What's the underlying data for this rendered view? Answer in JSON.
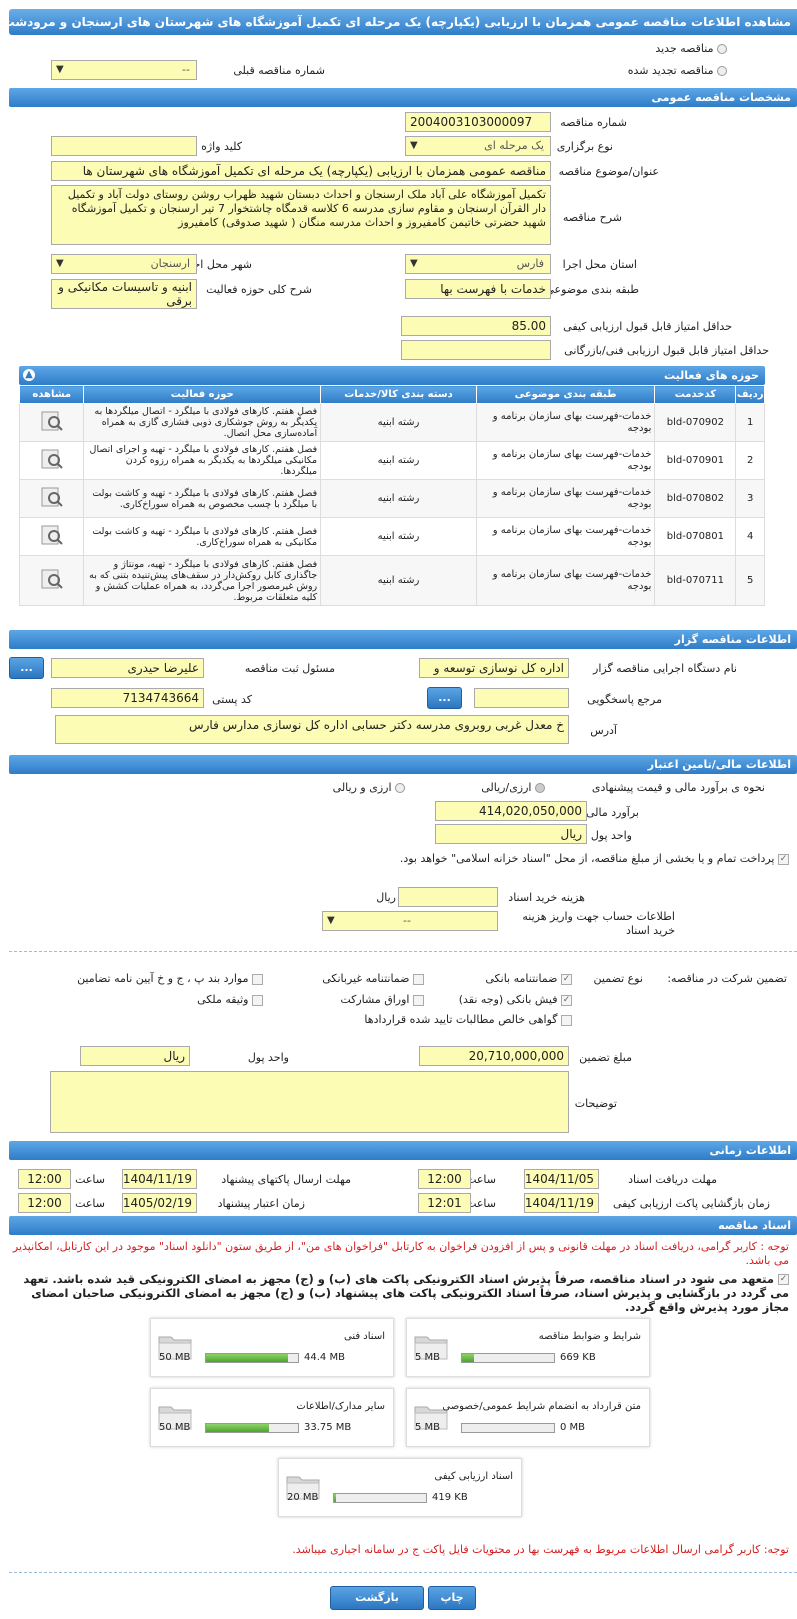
{
  "header": {
    "title": "مشاهده اطلاعات مناقصه عمومی همزمان با ارزیابی (یکپارچه) یک مرحله ای تکمیل آموزشگاه های شهرستان های ارسنجان و مرودشت"
  },
  "top": {
    "new_tender": "مناقصه جدید",
    "renewed_tender": "مناقصه تجدید شده",
    "prev_number_label": "شماره مناقصه قبلی",
    "prev_number_value": "--"
  },
  "general": {
    "title": "مشخصات مناقصه عمومی",
    "number_label": "شماره مناقصه",
    "number_value": "2004003103000097",
    "type_label": "نوع برگزاری",
    "type_value": "یک مرحله ای",
    "keyword_label": "کلید واژه",
    "keyword_value": "",
    "subject_label": "عنوان/موضوع مناقصه",
    "subject_value": "مناقصه عمومی همزمان با ارزیابی (یکپارچه) یک مرحله ای تکمیل آموزشگاه های شهرستان ها",
    "desc_label": "شرح مناقصه",
    "desc_value": "تکمیل آموزشگاه علی آباد ملک ارسنجان و احداث دبستان شهید ظهراب روشن روستای دولت آباد و تکمیل دار القرآن ارسنجان و مقاوم سازی مدرسه 6 کلاسه قدمگاه چاشتخوار 7 تیر ارسنجان و تکمیل آموزشگاه شهید حضرتی خاتیمن کامفیروز و احداث مدرسه منگان ( شهید صدوقی) کامفیروز",
    "province_label": "استان محل اجرا",
    "province_value": "فارس",
    "city_label": "شهر محل اجرا",
    "city_value": "ارسنجان",
    "category_label": "طبقه بندی موضوعی",
    "category_value": "خدمات با فهرست بها",
    "activity_label": "شرح کلی حوزه فعالیت",
    "activity_value": "ابنیه و تاسیسات مکانیکی و برقی",
    "min_quality_label": "حداقل امتیاز قابل قبول ارزیابی کیفی",
    "min_quality_value": "85.00",
    "min_tech_label": "حداقل امتیاز قابل قبول ارزیابی فنی/بازرگانی",
    "min_tech_value": ""
  },
  "activities": {
    "title": "حوزه های فعالیت",
    "columns": [
      "ردیف",
      "کدخدمت",
      "طبقه بندی موضوعی",
      "دسته بندی کالا/خدمات",
      "حوزه فعالیت",
      "مشاهده"
    ],
    "rows": [
      {
        "n": "1",
        "code": "bld-070902",
        "cat": "خدمات-فهرست بهای سازمان برنامه و بودجه",
        "group": "رشته ابنیه",
        "desc": "فصل هفتم. کارهای فولادی با میلگرد - اتصال میلگردها به یکدیگر به روش جوشکاری ذوبی فشاری گازی به همراه آماده‌سازی محل اتصال."
      },
      {
        "n": "2",
        "code": "bld-070901",
        "cat": "خدمات-فهرست بهای سازمان برنامه و بودجه",
        "group": "رشته ابنیه",
        "desc": "فصل هفتم. کارهای فولادی با میلگرد - تهیه و اجرای اتصال مکانیکی میلگردها به یکدیگر به همراه رزوه کردن میلگردها."
      },
      {
        "n": "3",
        "code": "bld-070802",
        "cat": "خدمات-فهرست بهای سازمان برنامه و بودجه",
        "group": "رشته ابنیه",
        "desc": "فصل هفتم. کارهای فولادی با میلگرد - تهیه و کاشت بولت با میلگرد با چسب مخصوص به همراه سوراخ‌کاری."
      },
      {
        "n": "4",
        "code": "bld-070801",
        "cat": "خدمات-فهرست بهای سازمان برنامه و بودجه",
        "group": "رشته ابنیه",
        "desc": "فصل هفتم. کارهای فولادی با میلگرد - تهیه و کاشت بولت مکانیکی به همراه سوراخ‌کاری."
      },
      {
        "n": "5",
        "code": "bld-070711",
        "cat": "خدمات-فهرست بهای سازمان برنامه و بودجه",
        "group": "رشته ابنیه",
        "desc": "فصل هفتم. کارهای فولادی با میلگرد - تهیه، مونتاژ و جاگذاری کابل روکش‌دار در سقف‌های پیش‌تنیده بتنی که به روش غیرمصور اجرا می‌گردد، به همراه عملیات کشش و کلیه متعلقات مربوط."
      }
    ]
  },
  "organizer": {
    "title": "اطلاعات مناقصه گزار",
    "org_label": "نام دستگاه اجرایی مناقصه گزار",
    "org_value": "اداره کل نوسازی توسعه و",
    "resp_label": "مسئول ثبت مناقصه",
    "resp_value": "علیرضا حیدری",
    "ref_label": "مرجع پاسخگویی",
    "ref_value": "",
    "postal_label": "کد پستی",
    "postal_value": "7134743664",
    "addr_label": "آدرس",
    "addr_value": "خ معدل غربی روبروی مدرسه دکتر حسابی اداره کل نوسازی مدارس فارس",
    "dots": "..."
  },
  "finance": {
    "title": "اطلاعات مالی/تامین اعتبار",
    "method_label": "نحوه ی برآورد مالی و قیمت پیشنهادی",
    "opt1": "ارزی/ریالی",
    "opt2": "ارزی و ریالی",
    "estimate_label": "برآورد مالی",
    "estimate_value": "414,020,050,000",
    "currency_label": "واحد پول",
    "currency_value": "ریال",
    "treasury_note": "پرداخت تمام و یا بخشی از مبلغ مناقصه، از محل \"اسناد خزانه اسلامی\" خواهد بود.",
    "doc_fee_label": "هزینه خرید اسناد",
    "doc_fee_value": "",
    "doc_fee_unit": "ریال",
    "account_label": "اطلاعات حساب جهت واریز هزینه خرید اسناد",
    "account_value": "--"
  },
  "guarantee": {
    "label": "تضمین شرکت در مناقصه:",
    "type_label": "نوع تضمین",
    "bank": "ضمانتنامه بانکی",
    "nonbank": "ضمانتنامه غیربانکی",
    "other": "موارد بند پ ، ج و خ آیین نامه تضامین",
    "cash": "فیش بانکی (وجه نقد)",
    "bonds": "اوراق مشارکت",
    "property": "وثیقه ملکی",
    "cert": "گواهی خالص مطالبات تایید شده قراردادها",
    "amount_label": "مبلغ تضمین",
    "amount_value": "20,710,000,000",
    "unit_label": "واحد پول",
    "unit_value": "ریال",
    "notes_label": "توضیحات",
    "notes_value": ""
  },
  "timing": {
    "title": "اطلاعات زمانی",
    "receive_label": "مهلت دریافت اسناد",
    "receive_date": "1404/11/05",
    "receive_time": "12:00",
    "send_label": "مهلت ارسال پاکتهای پیشنهاد",
    "send_date": "1404/11/19",
    "send_time": "12:00",
    "open_label": "زمان بازگشایی پاکت ارزیابی کیفی",
    "open_date": "1404/11/19",
    "open_time": "12:01",
    "valid_label": "زمان اعتبار پیشنهاد",
    "valid_date": "1405/02/19",
    "valid_time": "12:00",
    "hour": "ساعت"
  },
  "documents": {
    "title": "اسناد مناقصه",
    "note1": "توجه : کاربر گرامی، دریافت اسناد در مهلت قانونی و پس از افزودن فراخوان به کارتابل \"فراخوان های من\"، از طریق ستون \"دانلود اسناد\" موجود در این کارتابل، امکانپذیر می باشد.",
    "note2": "متعهد می شود در اسناد مناقصه، صرفاً پذیرش اسناد الکترونیکی پاکت های (ب) و (ج) مجهز به امضای الکترونیکی قید شده باشد. تعهد می گردد در بازگشایی و پذیرش اسناد، صرفاً اسناد الکترونیکی پاکت های پیشنهاد (ب) و (ج) مجهز به امضای الکترونیکی صاحبان امضای مجاز مورد پذیرش واقع گردد.",
    "files": [
      {
        "name": "شرایط و ضوابط مناقصه",
        "used": "669 KB",
        "max": "5 MB",
        "fill": 0.13
      },
      {
        "name": "اسناد فنی",
        "used": "44.4 MB",
        "max": "50 MB",
        "fill": 0.89
      },
      {
        "name": "متن قرارداد به انضمام شرایط عمومی/خصوصی",
        "used": "0 MB",
        "max": "5 MB",
        "fill": 0.0
      },
      {
        "name": "سایر مدارک/اطلاعات",
        "used": "33.75 MB",
        "max": "50 MB",
        "fill": 0.68
      },
      {
        "name": "اسناد ارزیابی کیفی",
        "used": "419 KB",
        "max": "20 MB",
        "fill": 0.02
      }
    ],
    "note3": "توجه: کاربر گرامی ارسال اطلاعات مربوط به فهرست بها در محتویات فایل پاکت ج در سامانه اجباری میباشد."
  },
  "actions": {
    "print": "چاپ",
    "back": "بازگشت"
  }
}
